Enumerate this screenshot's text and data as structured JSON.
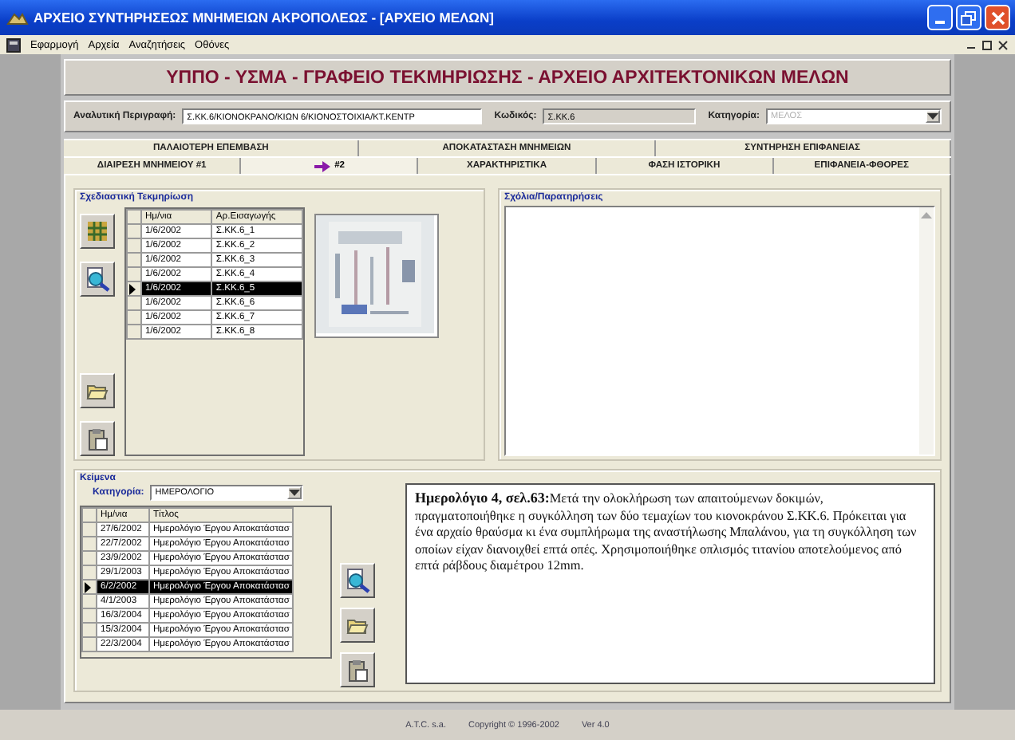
{
  "window": {
    "title": "ΑΡΧΕΙΟ ΣΥΝΤΗΡΗΣΕΩΣ ΜΝΗΜΕΙΩΝ ΑΚΡΟΠΟΛΕΩΣ - [ΑΡΧΕΙΟ ΜΕΛΩΝ]"
  },
  "menu": [
    "Εφαρμογή",
    "Αρχεία",
    "Αναζητήσεις",
    "Οθόνες"
  ],
  "header": "ΥΠΠΟ - ΥΣΜΑ - ΓΡΑΦΕΙΟ ΤΕΚΜΗΡΙΩΣΗΣ - ΑΡΧΕΙΟ ΑΡΧΙΤΕΚΤΟΝΙΚΩΝ ΜΕΛΩΝ",
  "fields": [
    {
      "kind": "text",
      "label": "Αναλυτική Περιγραφή:",
      "value": "Σ.ΚΚ.6/ΚΙΟΝΟΚΡΑΝΟ/ΚΙΩΝ 6/ΚΙΟΝΟΣΤΟΙΧΙΑ/ΚΤ.ΚΕΝΤΡ",
      "readonly": false,
      "disabled": false
    },
    {
      "kind": "text",
      "label": "Κωδικός:",
      "value": "Σ.ΚΚ.6",
      "readonly": true,
      "disabled": false
    },
    {
      "kind": "dropdown",
      "label": "Κατηγορία:",
      "value": "ΜΕΛΟΣ",
      "readonly": false,
      "disabled": true
    }
  ],
  "tab_rows": [
    {
      "tabs": [
        {
          "label": "ΠΑΛΑΙΟΤΕΡΗ ΕΠΕΜΒΑΣΗ",
          "selected": false
        },
        {
          "label": "ΑΠΟΚΑΤΑΣΤΑΣΗ ΜΝΗΜΕΙΩΝ",
          "selected": false
        },
        {
          "label": "ΣΥΝΤΗΡΗΣΗ ΕΠΙΦΑΝΕΙΑΣ",
          "selected": false
        }
      ]
    },
    {
      "tabs": [
        {
          "label": "ΔΙΑΙΡΕΣΗ ΜΝΗΜΕΙΟΥ #1",
          "selected": false
        },
        {
          "label": "#2",
          "selected": true
        },
        {
          "label": "ΧΑΡΑΚΤΗΡΙΣΤΙΚΑ",
          "selected": false
        },
        {
          "label": "ΦΑΣΗ ΙΣΤΟΡΙΚΗ",
          "selected": false
        },
        {
          "label": "ΕΠΙΦΑΝΕΙΑ-ΦΘΟΡΕΣ",
          "selected": false
        }
      ]
    }
  ],
  "drawings": {
    "title": "Σχεδιαστική Τεκμηρίωση",
    "columns": [
      "Ημ/νια",
      "Αρ.Εισαγωγής"
    ],
    "rows": [
      {
        "cells": [
          "1/6/2002",
          "Σ.ΚΚ.6_1"
        ],
        "selected": false
      },
      {
        "cells": [
          "1/6/2002",
          "Σ.ΚΚ.6_2"
        ],
        "selected": false
      },
      {
        "cells": [
          "1/6/2002",
          "Σ.ΚΚ.6_3"
        ],
        "selected": false
      },
      {
        "cells": [
          "1/6/2002",
          "Σ.ΚΚ.6_4"
        ],
        "selected": false
      },
      {
        "cells": [
          "1/6/2002",
          "Σ.ΚΚ.6_5"
        ],
        "selected": true
      },
      {
        "cells": [
          "1/6/2002",
          "Σ.ΚΚ.6_6"
        ],
        "selected": false
      },
      {
        "cells": [
          "1/6/2002",
          "Σ.ΚΚ.6_7"
        ],
        "selected": false
      },
      {
        "cells": [
          "1/6/2002",
          "Σ.ΚΚ.6_8"
        ],
        "selected": false
      }
    ]
  },
  "comments": {
    "title": "Σχόλια/Παρατηρήσεις"
  },
  "texts": {
    "title": "Κείμενα",
    "category_label": "Κατηγορία:",
    "category": "ΗΜΕΡΟΛΟΓΙΟ",
    "columns": [
      "Ημ/νια",
      "Τίτλος"
    ],
    "rows": [
      {
        "cells": [
          "27/6/2002",
          "Ημερολόγιο Έργου Αποκατάστασ"
        ],
        "selected": false
      },
      {
        "cells": [
          "22/7/2002",
          "Ημερολόγιο Έργου Αποκατάστασ"
        ],
        "selected": false
      },
      {
        "cells": [
          "23/9/2002",
          "Ημερολόγιο Έργου Αποκατάστασ"
        ],
        "selected": false
      },
      {
        "cells": [
          "29/1/2003",
          "Ημερολόγιο Έργου Αποκατάστασ"
        ],
        "selected": false
      },
      {
        "cells": [
          "6/2/2002",
          "Ημερολόγιο Έργου Αποκατάστασ"
        ],
        "selected": true
      },
      {
        "cells": [
          "4/1/2003",
          "Ημερολόγιο Έργου Αποκατάστασ"
        ],
        "selected": false
      },
      {
        "cells": [
          "16/3/2004",
          "Ημερολόγιο Έργου Αποκατάστασ"
        ],
        "selected": false
      },
      {
        "cells": [
          "15/3/2004",
          "Ημερολόγιο Έργου Αποκατάστασ"
        ],
        "selected": false
      },
      {
        "cells": [
          "22/3/2004",
          "Ημερολόγιο Έργου Αποκατάστασ"
        ],
        "selected": false
      }
    ],
    "body": "**Ημερολόγιο 4, σελ.63:**Μετά την ολοκλήρωση των απαιτούμενων δοκιμών, πραγματοποιήθηκε η συγκόλληση των δύο τεμαχίων του κιονοκράνου Σ.ΚΚ.6. Πρόκειται για ένα αρχαίο θραύσμα κι ένα συμπλήρωμα της αναστήλωσης Μπαλάνου, για τη συγκόλληση των οποίων είχαν διανοιχθεί επτά οπές. Χρησιμοποιήθηκε οπλισμός τιτανίου αποτελούμενος από επτά ράβδους διαμέτρου 12mm."
  },
  "status_bar": [
    "A.T.C. s.a.",
    "Copyright © 1996-2002",
    "Ver 4.0"
  ]
}
